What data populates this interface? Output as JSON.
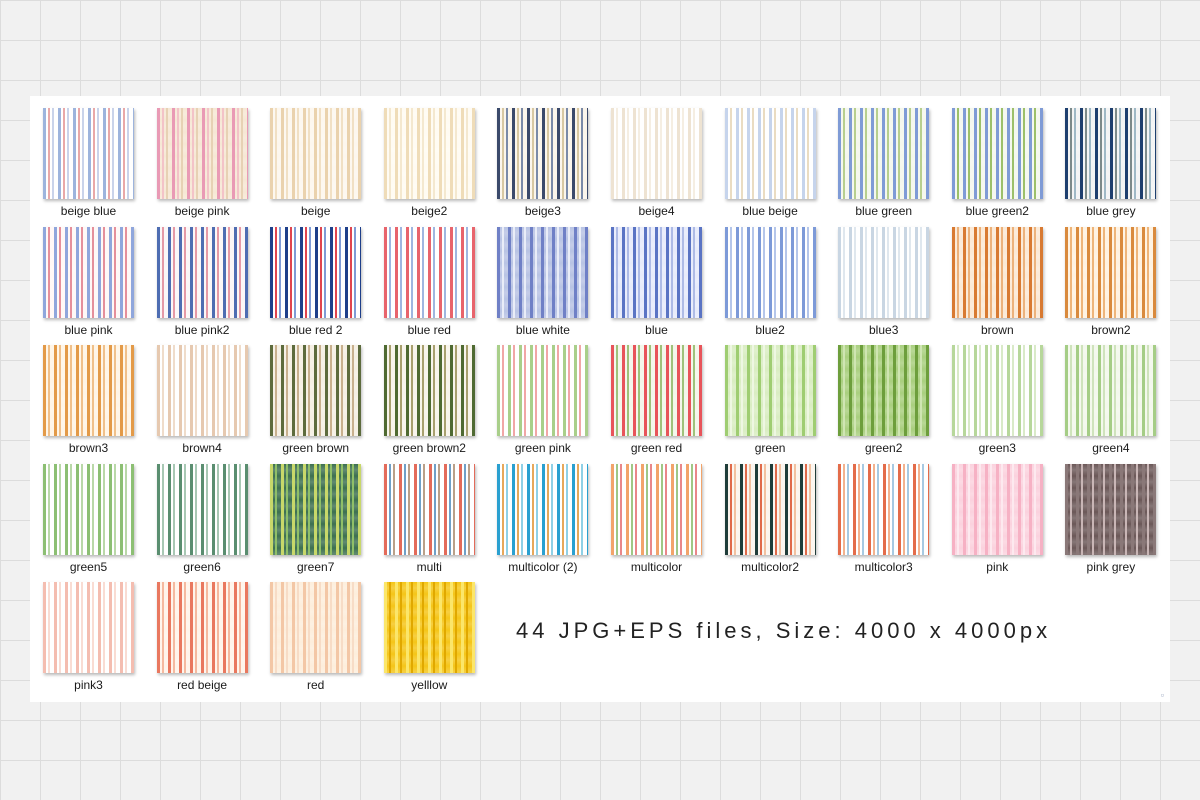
{
  "files": [
    {
      "name": "beige blue",
      "bg": "#ffffff",
      "stripes": [
        "#9db4dd",
        "#e8a8a8",
        "#c9d3ea"
      ]
    },
    {
      "name": "beige pink",
      "bg": "#f6e7d4",
      "stripes": [
        "#e99ab5",
        "#f3c3c8",
        "#e7d1b4"
      ]
    },
    {
      "name": "beige",
      "bg": "#fdf7ee",
      "stripes": [
        "#ead2ad",
        "#f1e0c4"
      ]
    },
    {
      "name": "beige2",
      "bg": "#fffbf2",
      "stripes": [
        "#efdcb8",
        "#f4e8cf"
      ]
    },
    {
      "name": "beige3",
      "bg": "#fbf5ea",
      "stripes": [
        "#3b4a6b",
        "#d8c8a2",
        "#7a8aa8"
      ]
    },
    {
      "name": "beige4",
      "bg": "#ffffff",
      "stripes": [
        "#eee3d2",
        "#f5eee2"
      ]
    },
    {
      "name": "blue beige",
      "bg": "#ffffff",
      "stripes": [
        "#c6d4ec",
        "#eadcc2"
      ]
    },
    {
      "name": "blue green",
      "bg": "#f4f7ec",
      "stripes": [
        "#7f9bd6",
        "#b7cf8e"
      ]
    },
    {
      "name": "blue green2",
      "bg": "#f4f7ee",
      "stripes": [
        "#7f9bd6",
        "#9cc06a"
      ]
    },
    {
      "name": "blue grey",
      "bg": "#f3f4f4",
      "stripes": [
        "#1e3f6f",
        "#7c8a8a",
        "#9fb9c6"
      ]
    },
    {
      "name": "blue pink",
      "bg": "#fff8f6",
      "stripes": [
        "#8fa6dc",
        "#e58f9b"
      ]
    },
    {
      "name": "blue pink2",
      "bg": "#fbf6f6",
      "stripes": [
        "#4e6db2",
        "#e599a6"
      ]
    },
    {
      "name": "blue red 2",
      "bg": "#ffffff",
      "stripes": [
        "#1e3f8a",
        "#e0454f",
        "#7f9bd6"
      ]
    },
    {
      "name": "blue red",
      "bg": "#ffffff",
      "stripes": [
        "#e8646c",
        "#9fb6e0"
      ]
    },
    {
      "name": "blue white",
      "bg": "#b8c3e4",
      "stripes": [
        "#6f80c6",
        "#e9edf8"
      ]
    },
    {
      "name": "blue",
      "bg": "#e7ebfb",
      "stripes": [
        "#5a74c4",
        "#aebbe6"
      ]
    },
    {
      "name": "blue2",
      "bg": "#ffffff",
      "stripes": [
        "#7d9ad8",
        "#b5c6ea"
      ]
    },
    {
      "name": "blue3",
      "bg": "#ffffff",
      "stripes": [
        "#c9d6e3",
        "#dfe7ee"
      ]
    },
    {
      "name": "brown",
      "bg": "#fbe9d5",
      "stripes": [
        "#d87a32",
        "#ecb27c"
      ]
    },
    {
      "name": "brown2",
      "bg": "#fff2e0",
      "stripes": [
        "#d98a3d",
        "#eeb57a"
      ]
    },
    {
      "name": "brown3",
      "bg": "#fff5e6",
      "stripes": [
        "#e39a48",
        "#f0c08a"
      ]
    },
    {
      "name": "brown4",
      "bg": "#ffffff",
      "stripes": [
        "#e6c9b0",
        "#efdcca"
      ]
    },
    {
      "name": "green brown",
      "bg": "#f5efe3",
      "stripes": [
        "#5d6b3d",
        "#c8b08e"
      ]
    },
    {
      "name": "green brown2",
      "bg": "#f8f4ea",
      "stripes": [
        "#4f6a32",
        "#a8a06e"
      ]
    },
    {
      "name": "green pink",
      "bg": "#ffffff",
      "stripes": [
        "#a9cf8a",
        "#f1a6a6"
      ]
    },
    {
      "name": "green red",
      "bg": "#f3f6ea",
      "stripes": [
        "#e8545a",
        "#9fc27a"
      ]
    },
    {
      "name": "green",
      "bg": "#d9edc1",
      "stripes": [
        "#9fcd72",
        "#eef7e2"
      ]
    },
    {
      "name": "green2",
      "bg": "#a9cf7e",
      "stripes": [
        "#6d9e3c",
        "#cfe5b2"
      ]
    },
    {
      "name": "green3",
      "bg": "#ffffff",
      "stripes": [
        "#b7d79b",
        "#d9eac8"
      ]
    },
    {
      "name": "green4",
      "bg": "#f3f8ec",
      "stripes": [
        "#a5cd86",
        "#cfe3bc"
      ]
    },
    {
      "name": "green5",
      "bg": "#ffffff",
      "stripes": [
        "#8cbf73",
        "#b9d8a8"
      ]
    },
    {
      "name": "green6",
      "bg": "#ffffff",
      "stripes": [
        "#5a8e70",
        "#a8c8b4"
      ]
    },
    {
      "name": "green7",
      "bg": "#3e7050",
      "stripes": [
        "#c8d86a",
        "#8fbf68"
      ]
    },
    {
      "name": "multi",
      "bg": "#ffffff",
      "stripes": [
        "#e36b5a",
        "#6fa0c8",
        "#b9a089"
      ]
    },
    {
      "name": "multicolor (2)",
      "bg": "#ffffff",
      "stripes": [
        "#2aa0d0",
        "#e7a85a",
        "#8fd0e6"
      ]
    },
    {
      "name": "multicolor",
      "bg": "#ffffff",
      "stripes": [
        "#f2a46a",
        "#9fc786",
        "#e9878a"
      ]
    },
    {
      "name": "multicolor2",
      "bg": "#fbf5ee",
      "stripes": [
        "#1f3d3a",
        "#e06a4a",
        "#f2c1a0"
      ]
    },
    {
      "name": "multicolor3",
      "bg": "#ffffff",
      "stripes": [
        "#e36c4a",
        "#f3b28e",
        "#a6c9e2"
      ]
    },
    {
      "name": "pink",
      "bg": "#fbd2de",
      "stripes": [
        "#f6b1c4",
        "#fde9ef"
      ]
    },
    {
      "name": "pink grey",
      "bg": "#6b5858",
      "stripes": [
        "#8a7878",
        "#c9b6b6"
      ]
    },
    {
      "name": "pink3",
      "bg": "#ffffff",
      "stripes": [
        "#f4bdb0",
        "#f9dcd3"
      ]
    },
    {
      "name": "red beige",
      "bg": "#fff4ea",
      "stripes": [
        "#e9785f",
        "#f5b99f"
      ]
    },
    {
      "name": "red",
      "bg": "#fdeedc",
      "stripes": [
        "#f3c7a6",
        "#f7dcc6"
      ]
    },
    {
      "name": "yelllow",
      "bg": "#f5c518",
      "stripes": [
        "#fbe66a",
        "#e0a800"
      ]
    }
  ],
  "caption": "44 JPG+EPS files, Size: 4000 x 4000px"
}
